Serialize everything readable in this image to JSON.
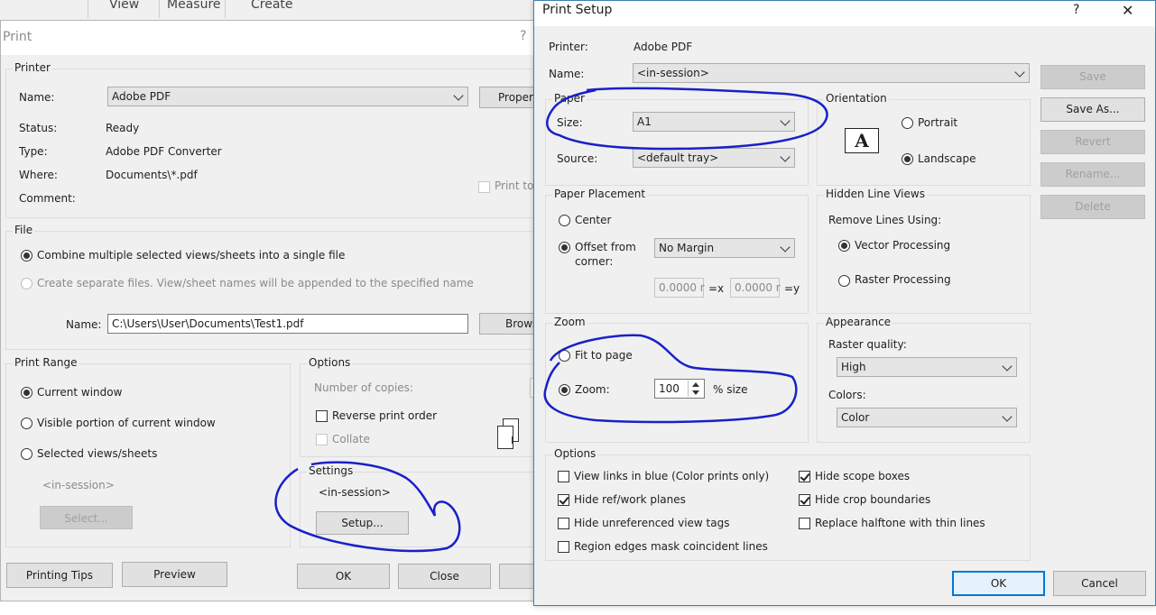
{
  "menubar": {
    "items": [
      "View",
      "Measure",
      "Create"
    ]
  },
  "print": {
    "title": "Print",
    "help": "?",
    "printer": {
      "group": "Printer",
      "name_label": "Name:",
      "name_value": "Adobe PDF",
      "properties": "Propert",
      "status_label": "Status:",
      "status_value": "Ready",
      "type_label": "Type:",
      "type_value": "Adobe PDF Converter",
      "where_label": "Where:",
      "where_value": "Documents\\*.pdf",
      "comment_label": "Comment:",
      "print_to_file": "Print to"
    },
    "file": {
      "group": "File",
      "combine": "Combine multiple selected views/sheets into a single file",
      "separate": "Create separate files. View/sheet names will be appended to the specified name",
      "name_label": "Name:",
      "name_value": "C:\\Users\\User\\Documents\\Test1.pdf",
      "browse": "Brows"
    },
    "range": {
      "group": "Print Range",
      "current": "Current window",
      "visible": "Visible portion of current window",
      "selected": "Selected views/sheets",
      "session": "<in-session>",
      "select_btn": "Select..."
    },
    "options": {
      "group": "Options",
      "copies": "Number of copies:",
      "reverse": "Reverse print order",
      "collate": "Collate"
    },
    "settings": {
      "group": "Settings",
      "value": "<in-session>",
      "setup_btn": "Setup..."
    },
    "buttons": {
      "tips": "Printing Tips",
      "preview": "Preview",
      "ok": "OK",
      "close": "Close"
    }
  },
  "setup": {
    "title": "Print Setup",
    "help": "?",
    "close": "✕",
    "printer_label": "Printer:",
    "printer_value": "Adobe PDF",
    "name_label": "Name:",
    "name_value": "<in-session>",
    "side_buttons": {
      "save": "Save",
      "save_as": "Save As...",
      "revert": "Revert",
      "rename": "Rename...",
      "delete": "Delete"
    },
    "paper": {
      "group": "Paper",
      "size_label": "Size:",
      "size_value": "A1",
      "source_label": "Source:",
      "source_value": "<default tray>"
    },
    "orientation": {
      "group": "Orientation",
      "portrait": "Portrait",
      "landscape": "Landscape",
      "icon_glyph": "A"
    },
    "placement": {
      "group": "Paper Placement",
      "center": "Center",
      "offset_1": "Offset from",
      "offset_2": "corner:",
      "margin_value": "No Margin",
      "x_value": "0.0000 r",
      "x_label": "=x",
      "y_value": "0.0000 r",
      "y_label": "=y"
    },
    "hidden": {
      "group": "Hidden Line Views",
      "remove": "Remove Lines Using:",
      "vector": "Vector Processing",
      "raster": "Raster Processing"
    },
    "zoom": {
      "group": "Zoom",
      "fit": "Fit to page",
      "zoom_label": "Zoom:",
      "zoom_value": "100",
      "unit": "% size"
    },
    "appearance": {
      "group": "Appearance",
      "raster_label": "Raster quality:",
      "raster_value": "High",
      "colors_label": "Colors:",
      "colors_value": "Color"
    },
    "options": {
      "group": "Options",
      "links_blue": "View links in blue (Color prints only)",
      "hide_ref": "Hide ref/work planes",
      "hide_unref": "Hide unreferenced view tags",
      "region_edges": "Region edges mask coincident lines",
      "hide_scope": "Hide scope boxes",
      "hide_crop": "Hide crop boundaries",
      "replace_halftone": "Replace halftone with thin lines"
    },
    "buttons": {
      "ok": "OK",
      "cancel": "Cancel"
    }
  },
  "annotation": {
    "color": "#1a20c8"
  }
}
